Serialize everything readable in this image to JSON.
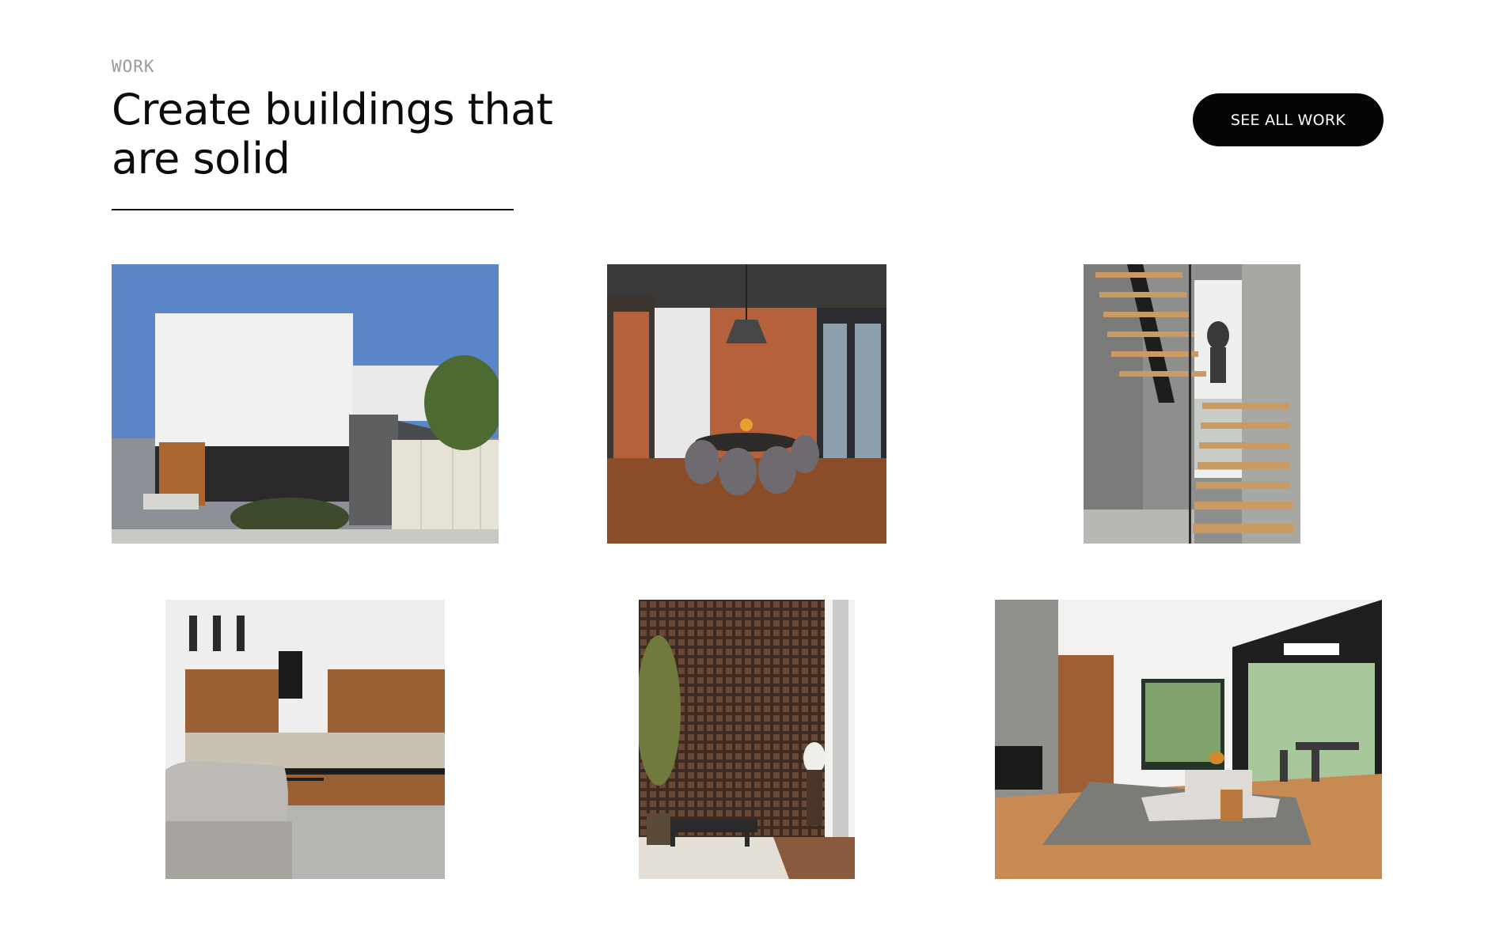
{
  "section": {
    "eyebrow": "WORK",
    "title": "Create buildings that are solid",
    "cta_label": "SEE ALL WORK"
  },
  "projects": [
    {
      "name": "white-house-exterior",
      "colors": {
        "sky": "#5b86c9",
        "wall": "#f1f1ef",
        "stone": "#5e5f61"
      }
    },
    {
      "name": "brick-dining-room",
      "colors": {
        "brick": "#b5623c",
        "floor": "#8a4d28",
        "ceiling": "#3b3a39"
      }
    },
    {
      "name": "floating-staircase",
      "colors": {
        "concrete": "#8e8f8c",
        "wood": "#c99a63",
        "steel": "#1d1d1d"
      }
    },
    {
      "name": "wood-kitchen",
      "colors": {
        "cabinet": "#9a5f33",
        "tile": "#c9c2b3",
        "floor": "#b4b6b2"
      }
    },
    {
      "name": "lattice-wall-lobby",
      "colors": {
        "lattice": "#5b3d2e",
        "floor": "#e4dfd6",
        "plant": "#6f7a3c"
      }
    },
    {
      "name": "open-living-room",
      "colors": {
        "wall": "#f3f2f0",
        "floor": "#c68a52",
        "sofa": "#dedbd6"
      }
    }
  ]
}
